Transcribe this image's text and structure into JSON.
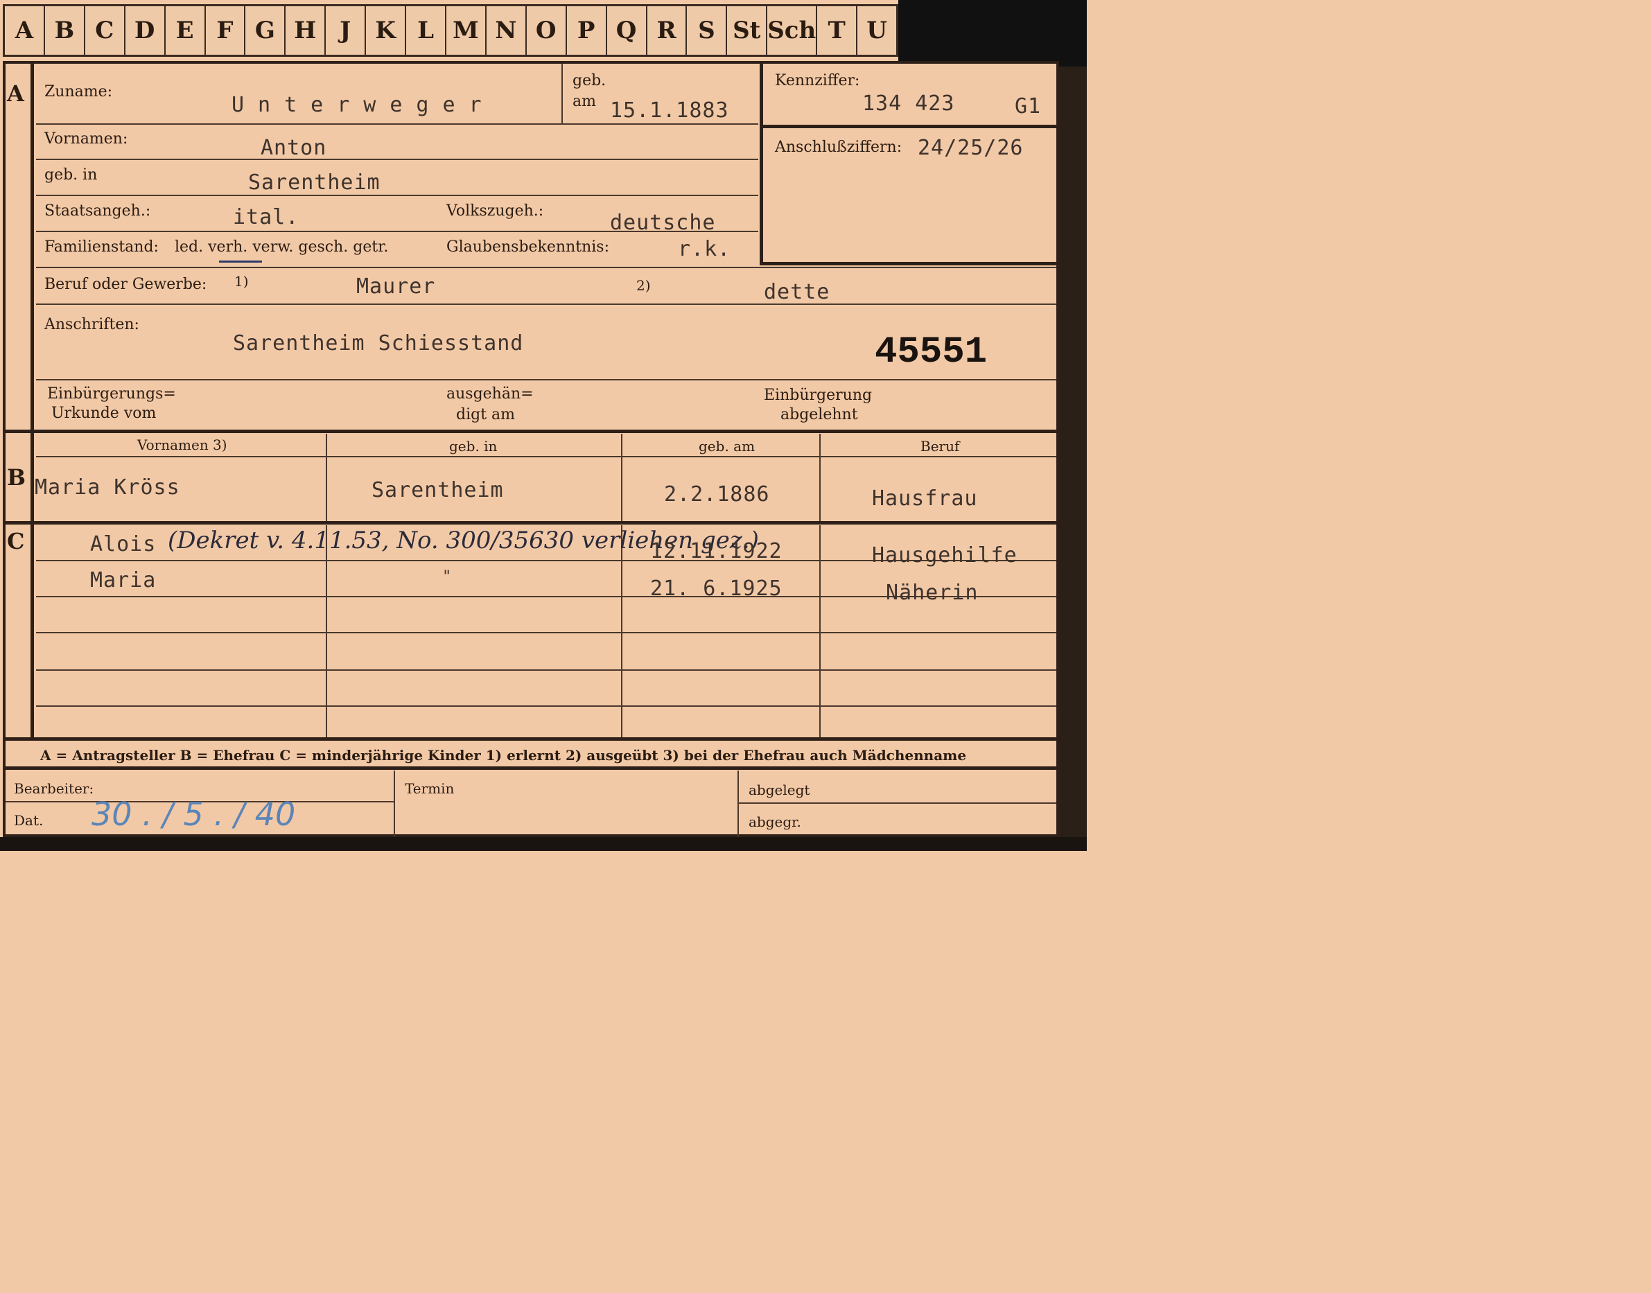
{
  "tabs": [
    "A",
    "B",
    "C",
    "D",
    "E",
    "F",
    "G",
    "H",
    "J",
    "K",
    "L",
    "M",
    "N",
    "O",
    "P",
    "Q",
    "R",
    "S",
    "St",
    "Sch",
    "T",
    "U"
  ],
  "section_labels": {
    "a": "A",
    "b": "B",
    "c": "C"
  },
  "applicant": {
    "surname_label": "Zuname:",
    "surname": "Unterweger",
    "born_on_label_1": "geb.",
    "born_on_label_2": "am",
    "born_on": "15.1.1883",
    "code_label": "Kennziffer:",
    "code_value": "134 423",
    "code_suffix": "G1",
    "connect_label": "Anschlußziffern:",
    "connect_value": "24/25/26",
    "first_names_label": "Vornamen:",
    "first_names": "Anton",
    "born_in_label": "geb. in",
    "born_in": "Sarentheim",
    "citizenship_label": "Staatsangeh.:",
    "citizenship": "ital.",
    "ethnicity_label": "Volkszugeh.:",
    "ethnicity": "deutsche",
    "marital_label": "Familienstand:",
    "marital_options": "led. verh. verw. gesch. getr.",
    "religion_label": "Glaubensbekenntnis:",
    "religion": "r.k.",
    "occupation_label": "Beruf oder Gewerbe:",
    "occupation_note_1": "1)",
    "occupation_learned": "Maurer",
    "occupation_note_2": "2)",
    "occupation_practiced": "dette",
    "address_label": "Anschriften:",
    "address": "Sarentheim Schiesstand",
    "file_number": "45551",
    "naturalization_cert_label_1": "Einbürgerungs=",
    "naturalization_cert_label_2": "Urkunde vom",
    "handed_label_1": "ausgehän=",
    "handed_label_2": "digt am",
    "rejected_label_1": "Einbürgerung",
    "rejected_label_2": "abgelehnt"
  },
  "spouse_table": {
    "headers": [
      "Vornamen 3)",
      "geb. in",
      "geb. am",
      "Beruf"
    ],
    "row": [
      "Maria Kröss",
      "Sarentheim",
      "2.2.1886",
      "Hausfrau"
    ]
  },
  "children": [
    {
      "name": "Alois",
      "born_in": "",
      "born_on": "12.11.1922",
      "occupation": "Hausgehilfe"
    },
    {
      "name": "Maria",
      "born_in": "\"",
      "born_on": "21. 6.1925",
      "occupation": "Näherin"
    }
  ],
  "handwritten_note": "(Dekret v. 4.11.53, No. 300/35630 verliehen gez.)",
  "legend": "A = Antragsteller    B = Ehefrau    C = minderjährige Kinder   1) erlernt    2) ausgeübt    3) bei der Ehefrau auch Mädchenname",
  "footer": {
    "clerk_label": "Bearbeiter:",
    "date_label": "Dat.",
    "date_value": "30 . / 5 . / 40",
    "deadline_label": "Termin",
    "filed_label": "abgelegt",
    "submitted_label": "abgegr."
  }
}
